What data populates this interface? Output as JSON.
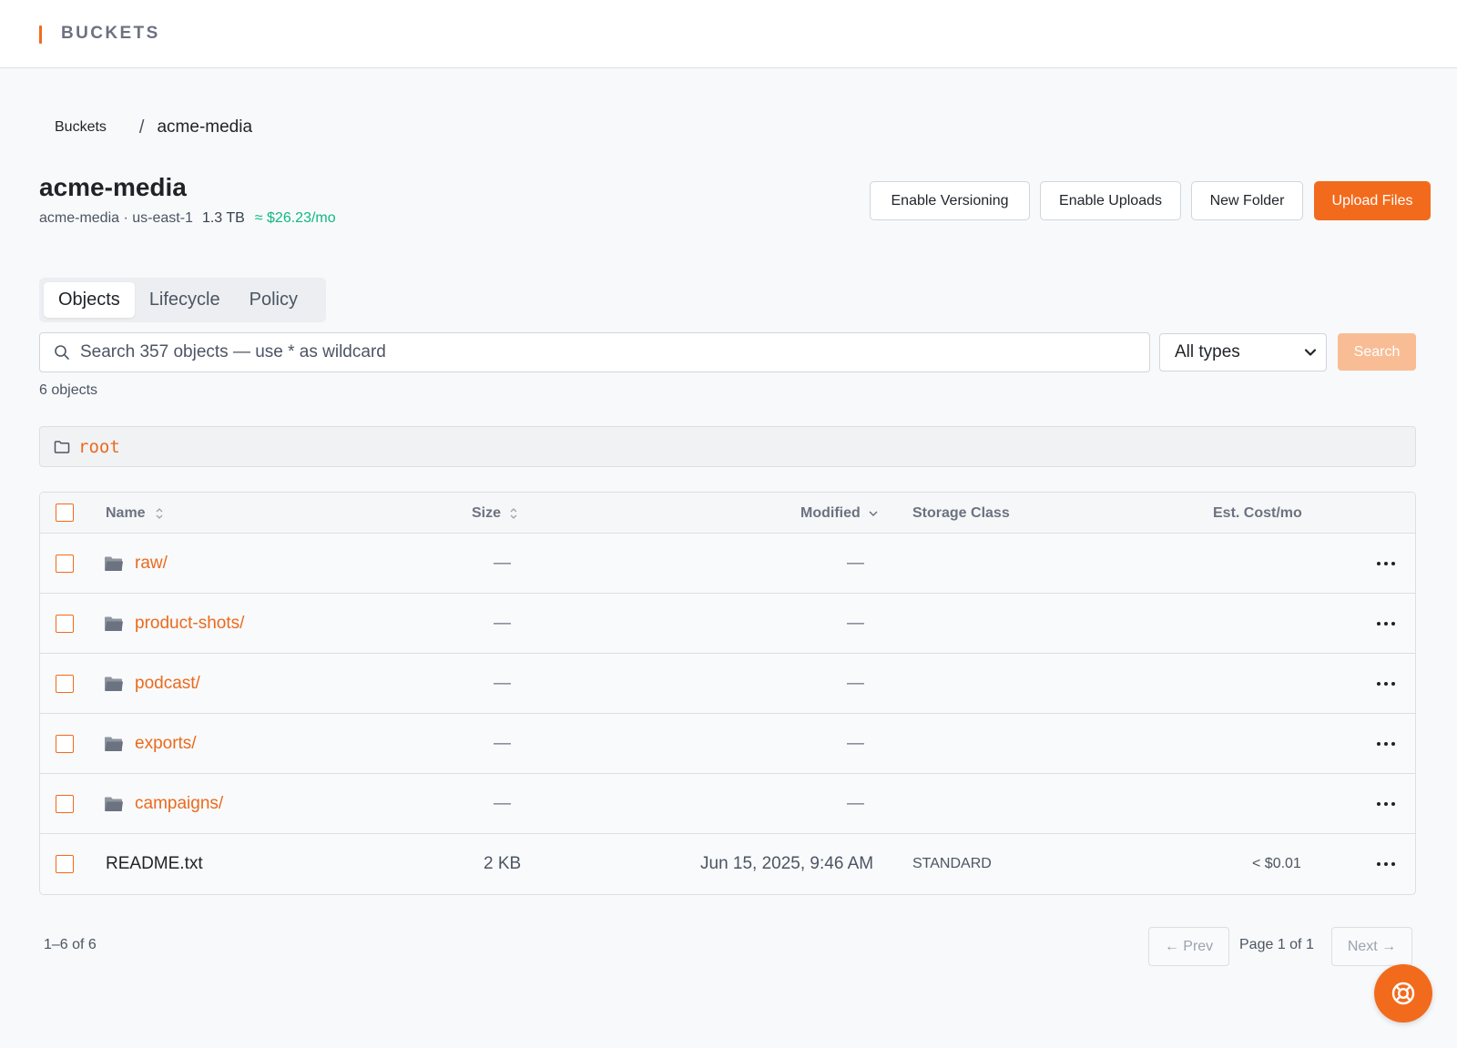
{
  "app": {
    "title": "BUCKETS",
    "accent": "#f26b1d"
  },
  "breadcrumb": {
    "root": "Buckets",
    "separator": "/",
    "current": "acme-media"
  },
  "bucket": {
    "name": "acme-media",
    "meta": "acme-media · us-east-1",
    "size": "1.3 TB",
    "cost": "≈ $26.23/mo"
  },
  "actions": {
    "enable_versioning": "Enable Versioning",
    "enable_uploads": "Enable Uploads",
    "new_folder": "New Folder",
    "upload_files": "Upload Files"
  },
  "tabs": [
    {
      "label": "Objects",
      "active": true
    },
    {
      "label": "Lifecycle",
      "active": false
    },
    {
      "label": "Policy",
      "active": false
    }
  ],
  "search": {
    "placeholder": "Search 357 objects — use * as wildcard",
    "type_filter": "All types",
    "button": "Search"
  },
  "object_count": "6 objects",
  "path": {
    "icon": "folder-outline-icon",
    "text": "root"
  },
  "table": {
    "columns": {
      "name": "Name",
      "size": "Size",
      "modified": "Modified",
      "storage_class": "Storage Class",
      "cost": "Est. Cost/mo"
    },
    "rows": [
      {
        "name": "raw/",
        "type": "folder",
        "size": "—",
        "modified": "—",
        "storage_class": "",
        "cost": ""
      },
      {
        "name": "product-shots/",
        "type": "folder",
        "size": "—",
        "modified": "—",
        "storage_class": "",
        "cost": ""
      },
      {
        "name": "podcast/",
        "type": "folder",
        "size": "—",
        "modified": "—",
        "storage_class": "",
        "cost": ""
      },
      {
        "name": "exports/",
        "type": "folder",
        "size": "—",
        "modified": "—",
        "storage_class": "",
        "cost": ""
      },
      {
        "name": "campaigns/",
        "type": "folder",
        "size": "—",
        "modified": "—",
        "storage_class": "",
        "cost": ""
      },
      {
        "name": "README.txt",
        "type": "file",
        "size": "2 KB",
        "modified": "Jun 15, 2025, 9:46 AM",
        "storage_class": "STANDARD",
        "cost": "< $0.01"
      }
    ]
  },
  "pagination": {
    "range": "1–6 of 6",
    "prev": "← Prev",
    "page": "Page 1 of 1",
    "next": "Next →"
  },
  "help": {
    "icon": "lifebuoy-icon"
  }
}
